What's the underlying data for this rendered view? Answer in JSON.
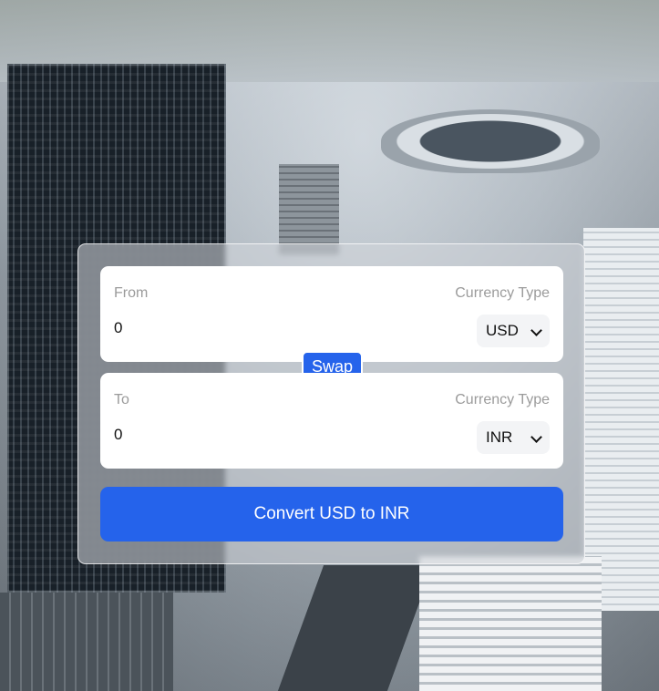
{
  "background": {
    "description_icon": "city-aerial-photo"
  },
  "converter": {
    "from": {
      "label": "From",
      "currency_label": "Currency Type",
      "amount": "0",
      "currency": "USD"
    },
    "swap_label": "Swap",
    "to": {
      "label": "To",
      "currency_label": "Currency Type",
      "amount": "0",
      "currency": "INR"
    },
    "convert_label": "Convert USD to INR"
  },
  "colors": {
    "accent": "#2563eb",
    "panel": "#ffffff",
    "muted_text": "#9b9b9b"
  }
}
